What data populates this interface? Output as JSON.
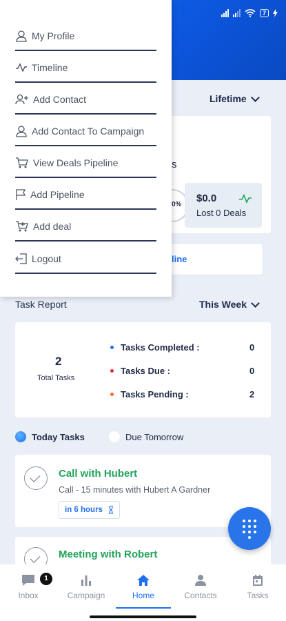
{
  "status_bar": {
    "battery": "7"
  },
  "dashboard": {
    "lifetime_filter": "Lifetime",
    "partial_text": "s",
    "ring_text": "0%",
    "deal_value": "$0.0",
    "deal_lost": "Lost 0 Deals",
    "pipeline_link_partial": "line"
  },
  "task_report": {
    "title": "Task Report",
    "filter": "This Week",
    "total_value": "2",
    "total_label": "Total Tasks",
    "stats": [
      {
        "label": "Tasks Completed :",
        "value": "0",
        "color": "#1e6ff1"
      },
      {
        "label": "Tasks Due :",
        "value": "0",
        "color": "#e0263b"
      },
      {
        "label": "Tasks Pending :",
        "value": "2",
        "color": "#f0682a"
      }
    ]
  },
  "tabs": [
    {
      "label": "Today Tasks",
      "active": true
    },
    {
      "label": "Due Tomorrow",
      "active": false
    }
  ],
  "tasks": [
    {
      "title": "Call with Hubert",
      "subtitle": "Call - 15 minutes  with Hubert A Gardner",
      "due": "in 6 hours"
    },
    {
      "title": "Meeting with Robert"
    }
  ],
  "drawer": {
    "items": [
      {
        "label": "My Profile",
        "icon": "user-icon"
      },
      {
        "label": "Timeline",
        "icon": "activity-icon"
      },
      {
        "label": "Add Contact",
        "icon": "user-plus-icon"
      },
      {
        "label": "Add Contact To Campaign",
        "icon": "user-icon"
      },
      {
        "label": "View Deals Pipeline",
        "icon": "cart-icon"
      },
      {
        "label": "Add Pipeline",
        "icon": "flag-icon"
      },
      {
        "label": "Add deal",
        "icon": "cart-plus-icon"
      },
      {
        "label": "Logout",
        "icon": "logout-icon"
      }
    ]
  },
  "bottom_nav": {
    "items": [
      {
        "label": "Inbox",
        "icon": "chat-icon",
        "badge": "1"
      },
      {
        "label": "Campaign",
        "icon": "bar-chart-icon"
      },
      {
        "label": "Home",
        "icon": "home-icon",
        "active": true
      },
      {
        "label": "Contacts",
        "icon": "person-icon"
      },
      {
        "label": "Tasks",
        "icon": "calendar-icon"
      }
    ]
  },
  "colors": {
    "accent": "#1e6ff1",
    "task_title": "#20a35a"
  }
}
